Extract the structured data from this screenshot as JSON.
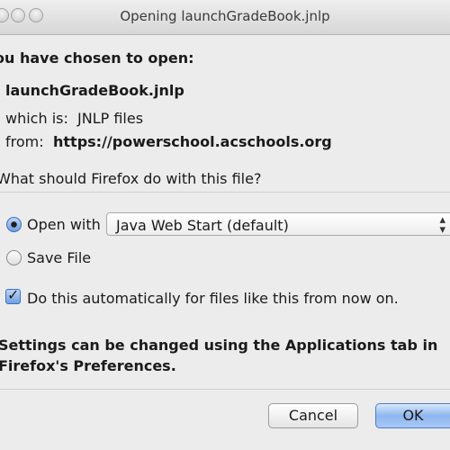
{
  "window": {
    "title": "Opening launchGradeBook.jnlp"
  },
  "dialog": {
    "heading": "ou have chosen to open:",
    "file_name": "launchGradeBook.jnlp",
    "which_is_label": "which is:",
    "which_is_value": "JNLP files",
    "from_label": "from:",
    "from_value": "https://powerschool.acschools.org",
    "question": "What should Firefox do with this file?",
    "open_with_label": "Open with",
    "open_with_app": "Java Web Start (default)",
    "save_file_label": "Save File",
    "auto_label": "Do this automatically for files like this from now on.",
    "settings_note_line1": "Settings can be changed using the Applications tab in",
    "settings_note_line2": "Firefox's Preferences."
  },
  "buttons": {
    "cancel": "Cancel",
    "ok": "OK"
  },
  "state": {
    "selected_action": "open_with",
    "auto_checked": true
  },
  "colors": {
    "accent": "#6f9fde",
    "background": "#ececec"
  }
}
